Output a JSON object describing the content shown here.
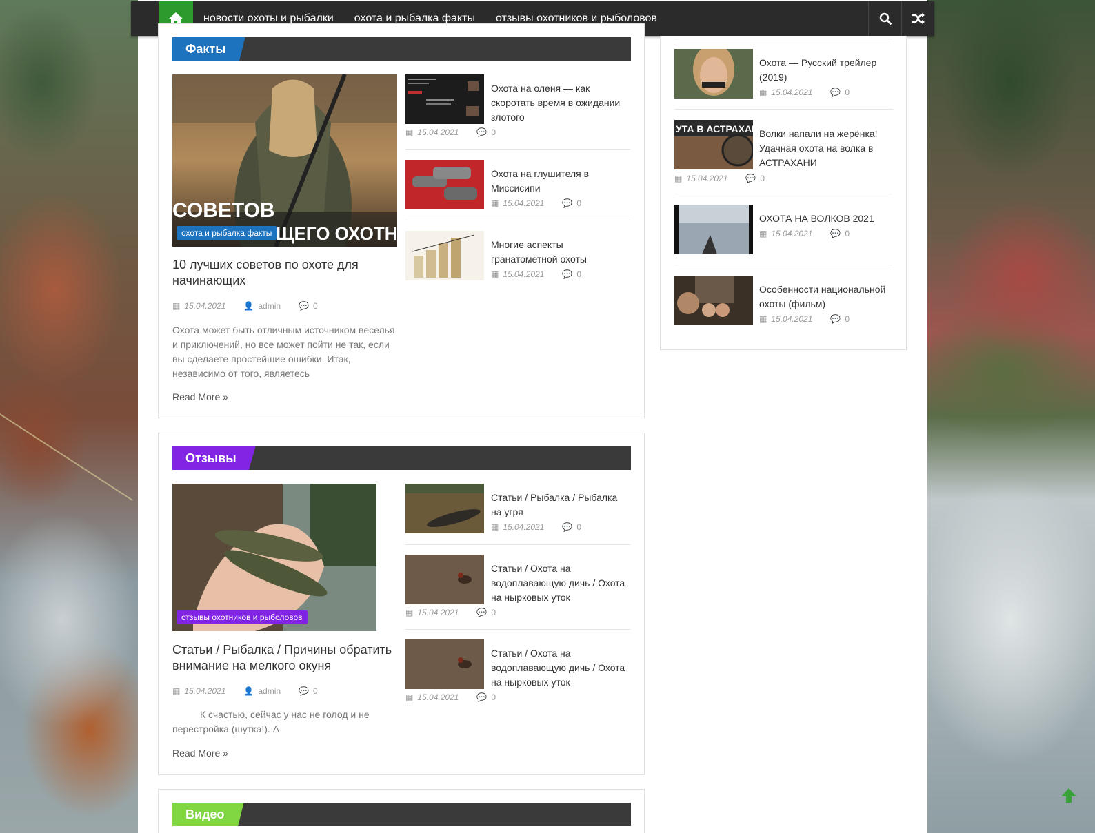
{
  "nav": {
    "items": [
      "новости охоты и рыбалки",
      "охота и рыбалка факты",
      "отзывы охотников и рыболовов"
    ],
    "home_icon": "home-icon",
    "search_icon": "search-icon",
    "random_icon": "shuffle-icon"
  },
  "colors": {
    "green": "#2c9a2c",
    "blue": "#1e73be",
    "purple": "#8224e3",
    "lime": "#81d742",
    "nav": "#2b2b2b"
  },
  "facts": {
    "title": "Факты",
    "featured": {
      "category": "охота и рыбалка факты",
      "image_text": "СОВЕТОВ\nЩЕГО ОХОТНИ",
      "title": "10 лучших советов по охоте для начинающих",
      "date": "15.04.2021",
      "author": "admin",
      "comments": "0",
      "excerpt": "Охота может быть отличным источником веселья и приключений, но все может пойти не так, если вы сделаете простейшие ошибки. Итак, независимо от того, являетесь",
      "read_more": "Read More »"
    },
    "items": [
      {
        "title": "Охота на оленя — как скоротать время в ожидании злотого",
        "date": "15.04.2021",
        "comments": "0"
      },
      {
        "title": "Охота на глушителя в Миссисипи",
        "date": "15.04.2021",
        "comments": "0"
      },
      {
        "title": "Многие аспекты гранатометной охоты",
        "date": "15.04.2021",
        "comments": "0"
      }
    ]
  },
  "reviews": {
    "title": "Отзывы",
    "featured": {
      "category": "отзывы охотников и рыболовов",
      "title": "Статьи / Рыбалка / Причины обратить внимание на мелкого окуня",
      "date": "15.04.2021",
      "author": "admin",
      "comments": "0",
      "excerpt": "К счастью, сейчас у нас не голод и не перестройка (шутка!). А",
      "read_more": "Read More »"
    },
    "items": [
      {
        "title": "Статьи / Рыбалка / Рыбалка на угря",
        "date": "15.04.2021",
        "comments": "0"
      },
      {
        "title": "Статьи / Охота на водоплавающую дичь / Охота на нырковых уток",
        "date": "15.04.2021",
        "comments": "0"
      },
      {
        "title": "Статьи / Охота на водоплавающую дичь / Охота на нырковых уток",
        "date": "15.04.2021",
        "comments": "0"
      }
    ]
  },
  "video": {
    "title": "Видео"
  },
  "sidebar": {
    "items": [
      {
        "title": "Охота — Русский трейлер (2019)",
        "date": "15.04.2021",
        "comments": "0"
      },
      {
        "title": "Волки напали на жерёнка! Удачная охота на волка в АСТРАХАНИ",
        "thumb_text": "УТА В АСТРАХАН",
        "date": "15.04.2021",
        "comments": "0"
      },
      {
        "title": "ОХОТА НА ВОЛКОВ 2021",
        "date": "15.04.2021",
        "comments": "0"
      },
      {
        "title": "Особенности национальной охоты (фильм)",
        "date": "15.04.2021",
        "comments": "0"
      }
    ]
  }
}
